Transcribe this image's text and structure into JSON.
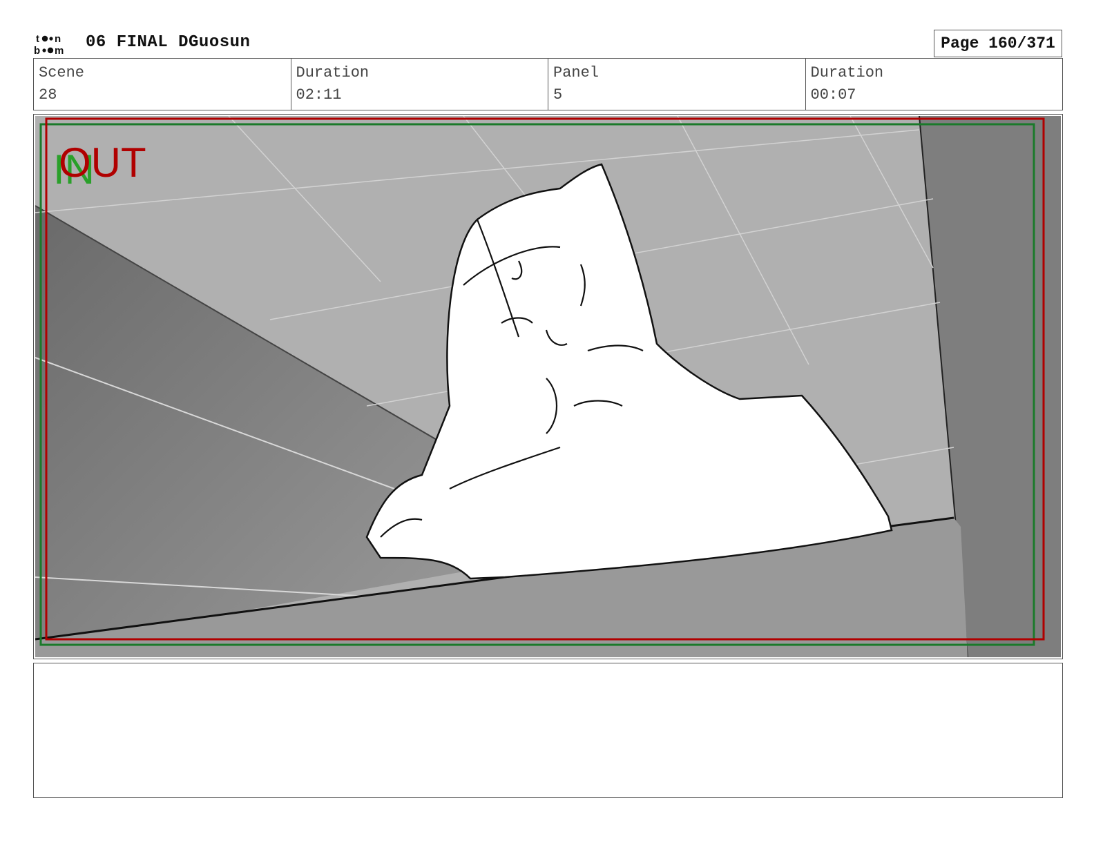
{
  "header": {
    "logo_text_top": "t●●n",
    "logo_text_bottom": "b●●m",
    "title": "06 FINAL DGuosun",
    "page_label": "Page 160/371"
  },
  "info": {
    "scene_label": "Scene",
    "scene_value": "28",
    "scene_duration_label": "Duration",
    "scene_duration_value": "02:11",
    "panel_label": "Panel",
    "panel_value": "5",
    "panel_duration_label": "Duration",
    "panel_duration_value": "00:07"
  },
  "panel": {
    "in_marker": "IN",
    "out_marker": "OUT",
    "colors": {
      "safe_frame": "#1a7a2a",
      "action_frame": "#b00000",
      "in_text": "#2aa02a",
      "out_text": "#b00000"
    }
  },
  "notes": {
    "text": ""
  }
}
